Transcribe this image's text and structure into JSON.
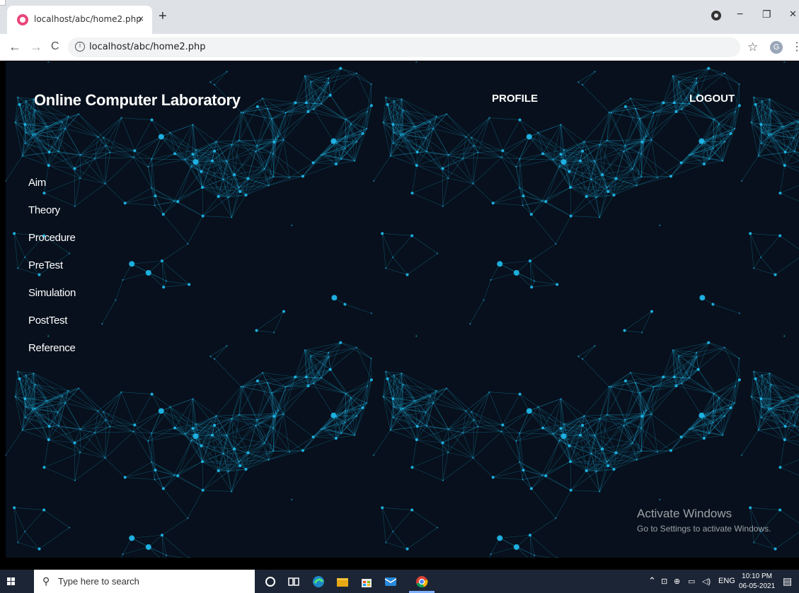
{
  "browser": {
    "tab_title": "localhost/abc/home2.php",
    "tab_close": "×",
    "new_tab": "+",
    "url": "localhost/abc/home2.php",
    "back": "←",
    "forward": "→",
    "reload": "C",
    "info": "i",
    "star": "☆",
    "profile_initial": "G",
    "menu": "⋮",
    "minimize": "−",
    "restore": "❐",
    "close": "✕"
  },
  "site": {
    "title": "Online Computer Laboratory",
    "profile_link": "PROFILE",
    "logout_link": "LOGOUT",
    "menu": [
      "Aim",
      "Theory",
      "Procedure",
      "PreTest",
      "Simulation",
      "PostTest",
      "Reference"
    ]
  },
  "watermark": {
    "line1": "Activate Windows",
    "line2": "Go to Settings to activate Windows."
  },
  "taskbar": {
    "search_placeholder": "Type here to search",
    "tray_lang": "ENG",
    "time": "10:10 PM",
    "date": "06-05-2021"
  },
  "colors": {
    "page_bg": "#07101c",
    "network": "#1fb6e8",
    "taskbar": "#1c2535"
  }
}
